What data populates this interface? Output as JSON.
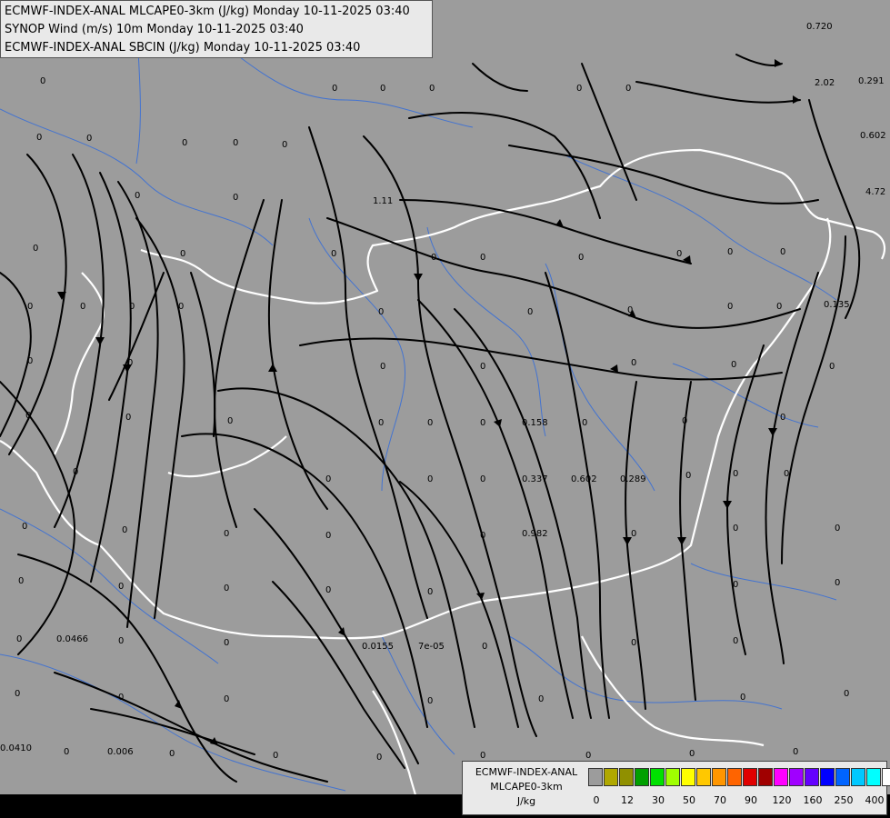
{
  "header": {
    "lines": [
      "ECMWF-INDEX-ANAL MLCAPE0-3km (J/kg) Monday 10-11-2025 03:40",
      "SYNOP Wind (m/s) 10m Monday 10-11-2025 03:40",
      "ECMWF-INDEX-ANAL SBCIN (J/kg) Monday 10-11-2025 03:40"
    ]
  },
  "legend": {
    "title_lines": [
      "ECMWF-INDEX-ANAL",
      "MLCAPE0-3km",
      "J/kg"
    ],
    "colors": [
      "#9c9c9c",
      "#b0a800",
      "#909000",
      "#00a000",
      "#00e000",
      "#a0ff00",
      "#ffff00",
      "#ffc800",
      "#ff9600",
      "#ff6400",
      "#e00000",
      "#a00000",
      "#ff00ff",
      "#a000ff",
      "#6400ff",
      "#0000ff",
      "#0064ff",
      "#00c8ff",
      "#00ffff",
      "#ffffff"
    ],
    "tick_labels": [
      "0",
      "12",
      "30",
      "50",
      "70",
      "90",
      "120",
      "160",
      "250",
      "400"
    ]
  },
  "map": {
    "values": [
      "0",
      "0.720",
      "0.291",
      "2.02",
      "0.602",
      "4.72",
      "1.11",
      "0.135",
      "0.158",
      "0.337",
      "0.602",
      "0.289",
      "0.982",
      "0.0466",
      "0.0155",
      "7e-05",
      "0.0410",
      "0.006"
    ]
  }
}
